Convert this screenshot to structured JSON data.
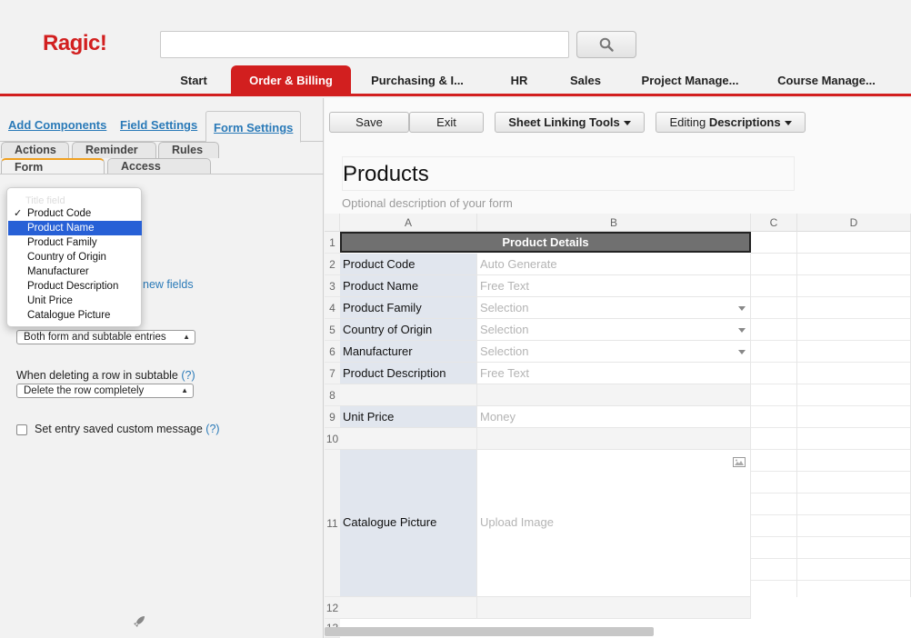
{
  "app": {
    "logo": "Ragic!"
  },
  "header": {
    "search_placeholder": "",
    "tabs": [
      {
        "label": "Start"
      },
      {
        "label": "Order & Billing"
      },
      {
        "label": "Purchasing & I..."
      },
      {
        "label": "HR"
      },
      {
        "label": "Sales"
      },
      {
        "label": "Project Manage..."
      },
      {
        "label": "Course Manage..."
      }
    ],
    "active_tab": "Order & Billing",
    "accent_color": "#d21f1f"
  },
  "left_panel": {
    "tabs": [
      {
        "label": "Add Components"
      },
      {
        "label": "Field Settings"
      },
      {
        "label": "Form Settings"
      }
    ],
    "subtabs_row1": [
      {
        "label": "Actions"
      },
      {
        "label": "Reminder"
      },
      {
        "label": "Rules"
      }
    ],
    "subtabs_row2": [
      {
        "label": "Form Settings"
      },
      {
        "label": "Access Rights"
      }
    ],
    "title_field_dropdown": {
      "faded_label": "Title field",
      "options": [
        "Product Code",
        "Product Name",
        "Product Family",
        "Country of Origin",
        "Manufacturer",
        "Product Description",
        "Unit Price",
        "Catalogue Picture"
      ],
      "checked": "Product Code",
      "highlighted": "Product Name",
      "check_mark": "✓"
    },
    "new_fields_link": "new fields",
    "apply_to_select": "Both form and subtable entries",
    "delete_row_label": "When deleting a row in subtable",
    "delete_row_help": "(?)",
    "delete_row_select": "Delete the row completely",
    "custom_message_label": "Set entry saved custom message",
    "custom_message_help": "(?)"
  },
  "toolbar": {
    "save": "Save",
    "exit": "Exit",
    "sheet_linking": "Sheet Linking Tools",
    "editing_prefix": "Editing",
    "editing_value": "Descriptions"
  },
  "form": {
    "title": "Products",
    "description": "Optional description of your form"
  },
  "grid": {
    "columns": [
      "A",
      "B",
      "C",
      "D"
    ],
    "header_title": "Product Details",
    "rows": [
      {
        "n": "1",
        "label": "",
        "value": "",
        "dropdown": false
      },
      {
        "n": "2",
        "label": "Product Code",
        "value": "Auto Generate",
        "dropdown": false
      },
      {
        "n": "3",
        "label": "Product Name",
        "value": "Free Text",
        "dropdown": false
      },
      {
        "n": "4",
        "label": "Product Family",
        "value": "Selection",
        "dropdown": true
      },
      {
        "n": "5",
        "label": "Country of Origin",
        "value": "Selection",
        "dropdown": true
      },
      {
        "n": "6",
        "label": "Manufacturer",
        "value": "Selection",
        "dropdown": true
      },
      {
        "n": "7",
        "label": "Product Description",
        "value": "Free Text",
        "dropdown": false
      },
      {
        "n": "8",
        "label": "",
        "value": "",
        "dropdown": false
      },
      {
        "n": "9",
        "label": "Unit Price",
        "value": "Money",
        "dropdown": false
      },
      {
        "n": "10",
        "label": "",
        "value": "",
        "dropdown": false
      },
      {
        "n": "11",
        "label": "Catalogue Picture",
        "value": "Upload Image",
        "dropdown": false
      },
      {
        "n": "12",
        "label": "",
        "value": "",
        "dropdown": false
      },
      {
        "n": "13",
        "label": "",
        "value": "",
        "dropdown": false
      }
    ]
  }
}
